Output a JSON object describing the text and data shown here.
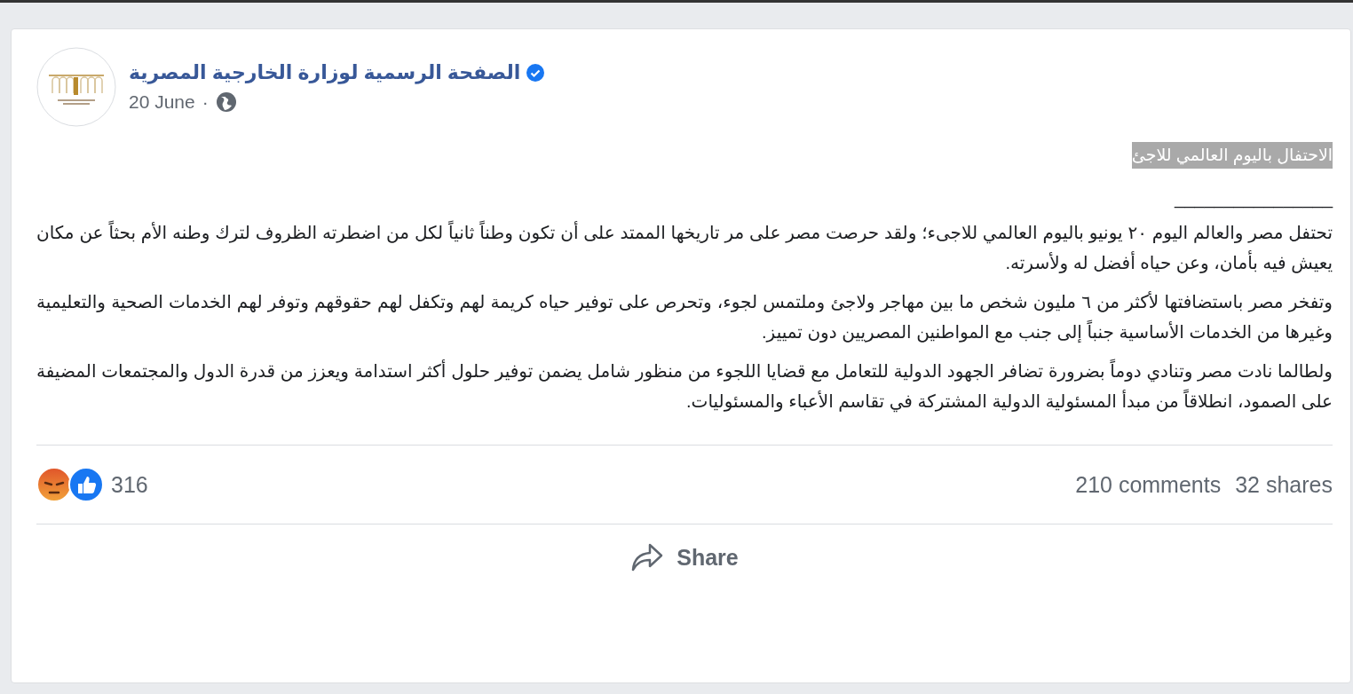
{
  "post": {
    "author": "الصفحة الرسمية لوزارة الخارجية المصرية",
    "verified": true,
    "date": "20 June",
    "separator": "·",
    "heading": {
      "text": "الاحتفال باليوم العالمي للاجئ",
      "highlighted": true
    },
    "rule_text": "________________",
    "paragraphs": [
      "تحتفل مصر والعالم اليوم ٢٠ يونيو باليوم العالمي للاجىء؛ ولقد حرصت مصر على مر تاريخها الممتد على أن تكون وطناً ثانياً لكل من اضطرته الظروف لترك وطنه الأم بحثاً عن مكان يعيش فيه بأمان، وعن حياه أفضل له ولأسرته.",
      "وتفخر مصر باستضافتها لأكثر من ٦ مليون شخص ما بين مهاجر ولاجئ وملتمس لجوء، وتحرص على توفير حياه كريمة لهم وتكفل لهم حقوقهم وتوفر لهم الخدمات الصحية والتعليمية وغيرها من الخدمات الأساسية جنباً إلى جنب مع المواطنين المصريين دون تمييز.",
      "ولطالما نادت مصر وتنادي دوماً بضرورة تضافر الجهود الدولية للتعامل مع قضايا اللجوء من منظور شامل يضمن توفير حلول أكثر استدامة ويعزز من قدرة الدول والمجتمعات المضيفة على الصمود، انطلاقاً من مبدأ المسئولية الدولية المشتركة في تقاسم الأعباء والمسئوليات."
    ],
    "reactions": {
      "types": [
        {
          "kind": "angry"
        },
        {
          "kind": "like"
        }
      ],
      "count": "316"
    },
    "comments": "210 comments",
    "shares": "32 shares",
    "actions": [
      {
        "kind": "share",
        "label": "Share"
      }
    ]
  }
}
